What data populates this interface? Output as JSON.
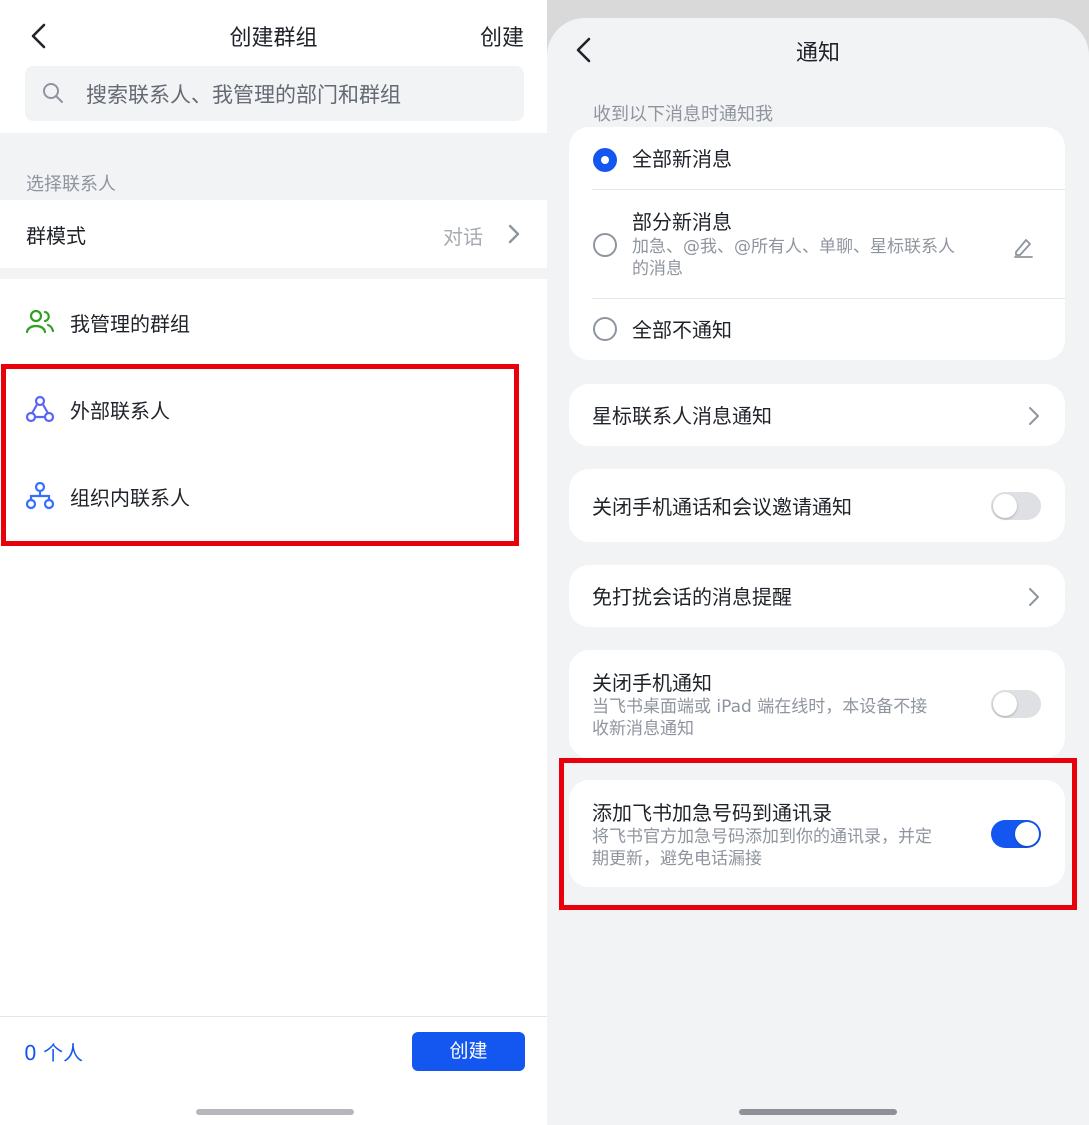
{
  "left": {
    "header": {
      "title": "创建群组",
      "create_label": "创建"
    },
    "search": {
      "placeholder": "搜索联系人、我管理的部门和群组"
    },
    "section_label": "选择联系人",
    "group_mode": {
      "label": "群模式",
      "value": "对话"
    },
    "items": [
      {
        "label": "我管理的群组",
        "icon": "people-icon"
      },
      {
        "label": "外部联系人",
        "icon": "triangle-nodes-icon"
      },
      {
        "label": "组织内联系人",
        "icon": "org-tree-icon"
      }
    ],
    "footer": {
      "count": "0 个人",
      "create_button": "创建"
    },
    "accent": "#1456f0"
  },
  "right": {
    "header": {
      "title": "通知"
    },
    "section_label": "收到以下消息时通知我",
    "options": [
      {
        "label": "全部新消息",
        "selected": true
      },
      {
        "label": "部分新消息",
        "desc": "加急、@我、@所有人、单聊、星标联系人",
        "desc2": "的消息",
        "selected": false
      },
      {
        "label": "全部不通知",
        "selected": false
      }
    ],
    "star_contacts": {
      "label": "星标联系人消息通知"
    },
    "close_call": {
      "label": "关闭手机通话和会议邀请通知",
      "enabled": false
    },
    "dnd": {
      "label": "免打扰会话的消息提醒"
    },
    "close_phone": {
      "label": "关闭手机通知",
      "desc": "当飞书桌面端或 iPad 端在线时，本设备不接",
      "desc2": "收新消息通知",
      "enabled": false
    },
    "add_number": {
      "label": "添加飞书加急号码到通讯录",
      "desc": "将飞书官方加急号码添加到你的通讯录，并定",
      "desc2": "期更新，避免电话漏接",
      "enabled": true
    }
  },
  "colors": {
    "highlight": "#e8000b",
    "toggle_on": "#1456f0",
    "toggle_off": "#dee0e3"
  }
}
